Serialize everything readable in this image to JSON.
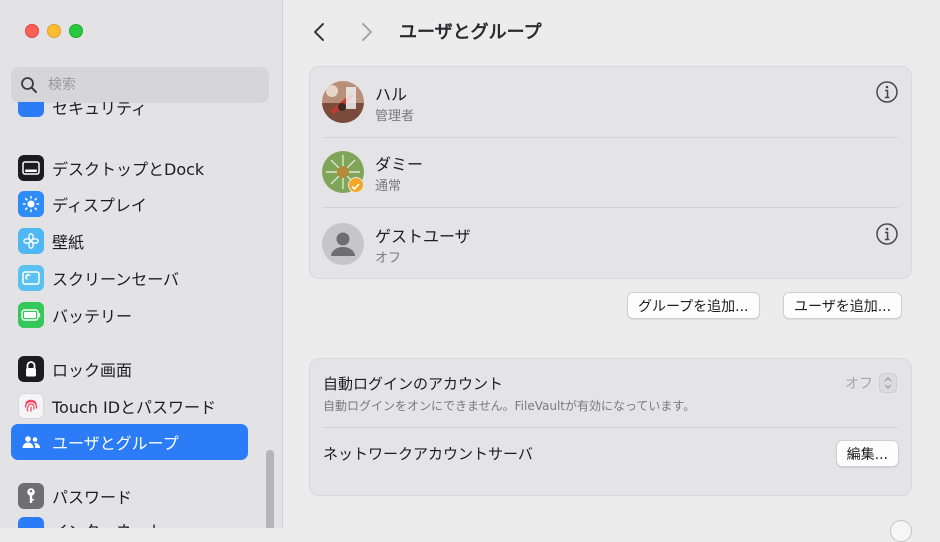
{
  "window": {
    "title": "ユーザとグループ"
  },
  "sidebar": {
    "search_placeholder": "検索",
    "items": [
      {
        "label": "セキュリティ",
        "icon": "shield-icon",
        "color": "#2b7cf6"
      },
      {
        "label": "デスクトップとDock",
        "icon": "dock-icon",
        "color": "#1c1c1e"
      },
      {
        "label": "ディスプレイ",
        "icon": "sun-icon",
        "color": "#2f8cf7"
      },
      {
        "label": "壁紙",
        "icon": "flower-icon",
        "color": "#4fb7f3"
      },
      {
        "label": "スクリーンセーバ",
        "icon": "screensaver-icon",
        "color": "#5ac1f0"
      },
      {
        "label": "バッテリー",
        "icon": "battery-icon",
        "color": "#34c759"
      },
      {
        "label": "ロック画面",
        "icon": "lock-icon",
        "color": "#1c1c1e"
      },
      {
        "label": "Touch IDとパスワード",
        "icon": "fingerprint-icon",
        "color": "#f5f5f5"
      },
      {
        "label": "ユーザとグループ",
        "icon": "users-icon",
        "color": "#2b7cf6"
      },
      {
        "label": "パスワード",
        "icon": "key-icon",
        "color": "#6e6e73"
      },
      {
        "label": "インターネット",
        "icon": "globe-icon",
        "color": "#2b7cf6"
      }
    ],
    "active_index": 8
  },
  "users": [
    {
      "name": "ハル",
      "role": "管理者",
      "has_info": true
    },
    {
      "name": "ダミー",
      "role": "通常",
      "has_info": false
    },
    {
      "name": "ゲストユーザ",
      "role": "オフ",
      "has_info": true
    }
  ],
  "actions": {
    "add_group": "グループを追加...",
    "add_user": "ユーザを追加..."
  },
  "auto_login": {
    "title": "自動ログインのアカウント",
    "description": "自動ログインをオンにできません。FileVaultが有効になっています。",
    "value": "オフ"
  },
  "network_server": {
    "title": "ネットワークアカウントサーバ",
    "edit_label": "編集..."
  },
  "colors": {
    "accent": "#2b7cf6",
    "sidebar_bg": "#e3e3e6",
    "card_bg": "#e4e4e6"
  }
}
